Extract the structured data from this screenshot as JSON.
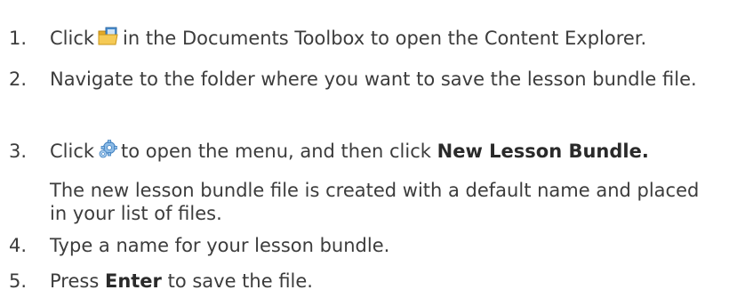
{
  "steps": [
    {
      "number": "1.",
      "text_before": "Click",
      "icon": "content-explorer-folder-icon",
      "text_after": "in the Documents Toolbox to open the Content Explorer."
    },
    {
      "number": "2.",
      "text": "Navigate to the folder where you want to save the lesson bundle file."
    },
    {
      "number": "3.",
      "text_before": "Click",
      "icon": "gear-icon",
      "text_middle": "to open the menu, and then click",
      "bold": "New Lesson Bundle.",
      "note": "The new lesson bundle file is created with a default name and placed in your list of files."
    },
    {
      "number": "4.",
      "text": "Type a name for your lesson bundle."
    },
    {
      "number": "5.",
      "text_before": "Press",
      "bold": "Enter",
      "text_after": "to save the file."
    }
  ],
  "colors": {
    "text": "#3c3c3c",
    "folder": "#f0c24a",
    "folder_dark": "#d9a21c",
    "screen": "#3f86c9",
    "gear": "#6fa6d8"
  }
}
